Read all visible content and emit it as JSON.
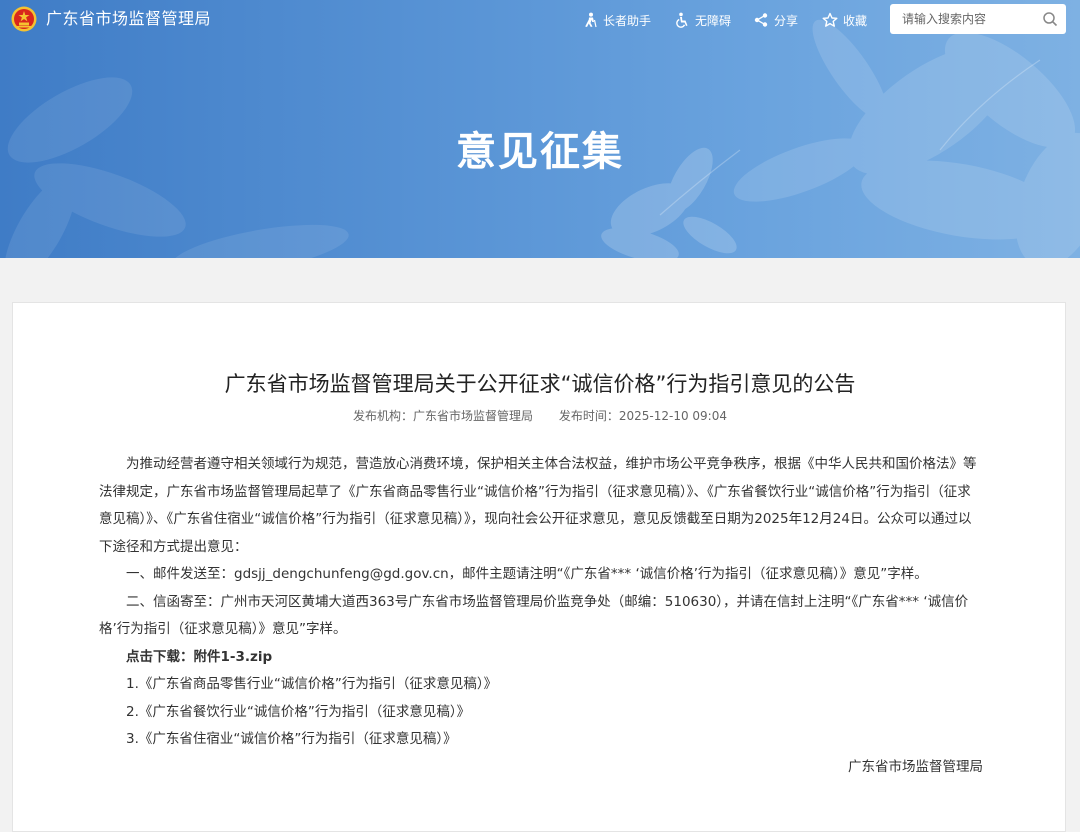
{
  "header": {
    "site_name": "广东省市场监督管理局",
    "tools": [
      {
        "label": "长者助手",
        "icon": "elderly-icon"
      },
      {
        "label": "无障碍",
        "icon": "accessibility-icon"
      },
      {
        "label": "分享",
        "icon": "share-icon"
      },
      {
        "label": "收藏",
        "icon": "star-icon"
      }
    ],
    "search": {
      "placeholder": "请输入搜索内容",
      "icon": "search-icon"
    }
  },
  "banner": {
    "title": "意见征集"
  },
  "article": {
    "title": "广东省市场监督管理局关于公开征求“诚信价格”行为指引意见的公告",
    "meta": {
      "publisher": "发布机构：广东省市场监督管理局",
      "time": "发布时间：2025-12-10 09:04"
    },
    "paragraphs": [
      "为推动经营者遵守相关领域行为规范，营造放心消费环境，保护相关主体合法权益，维护市场公平竞争秩序，根据《中华人民共和国价格法》等法律规定，广东省市场监督管理局起草了《广东省商品零售行业“诚信价格”行为指引（征求意见稿）》、《广东省餐饮行业“诚信价格”行为指引（征求意见稿）》、《广东省住宿业“诚信价格”行为指引（征求意见稿）》，现向社会公开征求意见，意见反馈截至日期为2025年12月24日。公众可以通过以下途径和方式提出意见：",
      "一、邮件发送至：gdsjj_dengchunfeng@gd.gov.cn，邮件主题请注明“《广东省*** ‘诚信价格’行为指引（征求意见稿）》意见”字样。",
      "二、信函寄至：广州市天河区黄埔大道西363号广东省市场监督管理局价监竞争处（邮编：510630），并请在信封上注明“《广东省*** ‘诚信价格’行为指引（征求意见稿）》意见”字样。"
    ],
    "download_label": "点击下载：附件1-3.zip",
    "attachments": [
      "1.《广东省商品零售行业“诚信价格”行为指引（征求意见稿）》",
      "2.《广东省餐饮行业“诚信价格”行为指引（征求意见稿）》",
      "3.《广东省住宿业“诚信价格”行为指引（征求意见稿）》"
    ],
    "signature": "广东省市场监督管理局"
  },
  "colors": {
    "banner_primary": "#4a86cc",
    "banner_light": "#7eb1e3",
    "emblem_red": "#d9261c",
    "emblem_gold": "#f5c230"
  }
}
